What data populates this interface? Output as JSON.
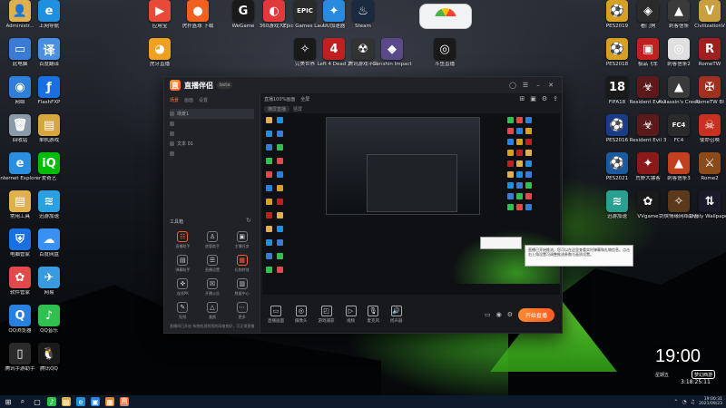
{
  "desktop": {
    "left_icons": [
      {
        "label": "Administr...",
        "icon": "user-folder-icon",
        "color": "#e0b050",
        "glyph": "👤"
      },
      {
        "label": "上网导航",
        "icon": "edge-icon",
        "color": "#1f8fe0",
        "glyph": "e"
      },
      {
        "label": "此电脑",
        "icon": "computer-icon",
        "color": "#3a7bd5",
        "glyph": "▭"
      },
      {
        "label": "百度翻译",
        "icon": "translate-icon",
        "color": "#4a90e2",
        "glyph": "译"
      },
      {
        "label": "网络",
        "icon": "network-icon",
        "color": "#2f7ed8",
        "glyph": "◉"
      },
      {
        "label": "FlashFXP",
        "icon": "flashfxp-icon",
        "color": "#1a6fe0",
        "glyph": "ƒ"
      },
      {
        "label": "回收站",
        "icon": "recycle-bin-icon",
        "color": "#8a9aa8",
        "glyph": "🗑"
      },
      {
        "label": "单机游戏",
        "icon": "folder-icon",
        "color": "#d8a640",
        "glyph": "▤"
      },
      {
        "label": "Internet Explorer",
        "icon": "ie-icon",
        "color": "#2a8fe0",
        "glyph": "e"
      },
      {
        "label": "爱奇艺",
        "icon": "iqiyi-icon",
        "color": "#00be06",
        "glyph": "iQ"
      },
      {
        "label": "常用工具",
        "icon": "tools-folder-icon",
        "color": "#e0b050",
        "glyph": "▤"
      },
      {
        "label": "迅游加速",
        "icon": "accelerator-icon",
        "color": "#2aa0e0",
        "glyph": "≋"
      },
      {
        "label": "电脑管家",
        "icon": "shield-icon",
        "color": "#1a70e0",
        "glyph": "⛨"
      },
      {
        "label": "百度网盘",
        "icon": "cloud-icon",
        "color": "#3a90f0",
        "glyph": "☁"
      },
      {
        "label": "软件管家",
        "icon": "software-manager-icon",
        "color": "#e04a4a",
        "glyph": "✿"
      },
      {
        "label": "网易",
        "icon": "plane-icon",
        "color": "#3a9ae0",
        "glyph": "✈"
      },
      {
        "label": "QQ浏览器",
        "icon": "qq-browser-icon",
        "color": "#2a80e0",
        "glyph": "Q"
      },
      {
        "label": "QQ音乐",
        "icon": "qq-music-icon",
        "color": "#30c050",
        "glyph": "♪"
      },
      {
        "label": "腾讯手游助手",
        "icon": "phone-game-icon",
        "color": "#2a2a2a",
        "glyph": "▯"
      },
      {
        "label": "腾讯QQ",
        "icon": "qq-icon",
        "color": "#1a1a1a",
        "glyph": "🐧"
      }
    ],
    "top_icons": [
      {
        "label": "应用宝",
        "icon": "app-store-icon",
        "color": "#e84a3a",
        "glyph": "▶"
      },
      {
        "label": "虎扑篮球 下载",
        "icon": "basketball-icon",
        "color": "#f06020",
        "glyph": "●"
      },
      {
        "label": "WeGame",
        "icon": "wegame-icon",
        "color": "#1a1a1a",
        "glyph": "G"
      },
      {
        "label": "360游戏大厅",
        "icon": "game360-icon",
        "color": "#e03a3a",
        "glyph": "◐"
      },
      {
        "label": "Epic Games Launcher",
        "icon": "epic-icon",
        "color": "#2a2a2a",
        "glyph": "EPIC"
      },
      {
        "label": "UU加速器",
        "icon": "uu-icon",
        "color": "#2a8ae0",
        "glyph": "✦"
      },
      {
        "label": "Steam",
        "icon": "steam-icon",
        "color": "#1a2a40",
        "glyph": "♨"
      },
      {
        "label": "虎牙直播",
        "icon": "huya-icon",
        "color": "#f0a020",
        "glyph": "◕"
      },
      {
        "label": "完美世界",
        "icon": "perfect-world-icon",
        "color": "#1a1a1a",
        "glyph": "✧"
      },
      {
        "label": "Left 4 Dead 2",
        "icon": "l4d2-icon",
        "color": "#c02020",
        "glyph": "4"
      },
      {
        "label": "腾讯游戏平台",
        "icon": "tencent-game-icon",
        "color": "#333",
        "glyph": "☢"
      },
      {
        "label": "Genshin Impact",
        "icon": "genshin-icon",
        "color": "#5a4a8a",
        "glyph": "◆"
      },
      {
        "label": "斗鱼直播",
        "icon": "douyu-icon",
        "color": "#1a1a1a",
        "glyph": "◎"
      }
    ],
    "right_icons": [
      {
        "label": "PES2019",
        "icon": "pes-icon",
        "color": "#d8a020",
        "glyph": "⚽"
      },
      {
        "label": "看门狗",
        "icon": "watchdogs-icon",
        "color": "#2a2a2a",
        "glyph": "◈"
      },
      {
        "label": "刺客信条",
        "icon": "assassin-icon",
        "color": "#3a3a3a",
        "glyph": "▲"
      },
      {
        "label": "CivilizationV",
        "icon": "civ-icon",
        "color": "#c8a040",
        "glyph": "V"
      },
      {
        "label": "PES2018",
        "icon": "pes2018-icon",
        "color": "#d8a020",
        "glyph": "⚽"
      },
      {
        "label": "极品飞车",
        "icon": "nfs-icon",
        "color": "#c02020",
        "glyph": "▣"
      },
      {
        "label": "刺客信条2",
        "icon": "assassin2-icon",
        "color": "#e0e0e0",
        "glyph": "◎"
      },
      {
        "label": "RomeTW",
        "icon": "rome-icon",
        "color": "#a02020",
        "glyph": "R"
      },
      {
        "label": "FIFA18",
        "icon": "fifa-icon",
        "color": "#1a1a1a",
        "glyph": "18"
      },
      {
        "label": "Resident Evil 2",
        "icon": "re2-icon",
        "color": "#5a1a1a",
        "glyph": "☣"
      },
      {
        "label": "Assassin's Creed",
        "icon": "ac-icon",
        "color": "#3a3a3a",
        "glyph": "▲"
      },
      {
        "label": "RomeTW BI",
        "icon": "rome-bi-icon",
        "color": "#a03020",
        "glyph": "✠"
      },
      {
        "label": "PES2016",
        "icon": "pes2016-icon",
        "color": "#1a3a8a",
        "glyph": "⚽"
      },
      {
        "label": "Resident Evil 3",
        "icon": "re3-icon",
        "color": "#5a1a1a",
        "glyph": "☣"
      },
      {
        "label": "FC4",
        "icon": "farcry-icon",
        "color": "#2a2a2a",
        "glyph": "FC4"
      },
      {
        "label": "使命召唤",
        "icon": "cod-icon",
        "color": "#c83020",
        "glyph": "☠"
      },
      {
        "label": "PES2021",
        "icon": "pes2021-icon",
        "color": "#1a5aa0",
        "glyph": "⚽"
      },
      {
        "label": "荒野大镖客",
        "icon": "rdr-icon",
        "color": "#8a1a1a",
        "glyph": "✦"
      },
      {
        "label": "刺客信条3",
        "icon": "ac3-icon",
        "color": "#c04020",
        "glyph": "▲"
      },
      {
        "label": "Rome2",
        "icon": "rome2-icon",
        "color": "#8a4a1a",
        "glyph": "⚔"
      },
      {
        "label": "迅游加速",
        "icon": "xunyou-icon",
        "color": "#2aa090",
        "glyph": "≋"
      },
      {
        "label": "VVgame",
        "icon": "vvgame-icon",
        "color": "#1a1a1a",
        "glyph": "✿"
      },
      {
        "label": "剑侠情缘网络版叁",
        "icon": "jx3-icon",
        "color": "#5a3a1a",
        "glyph": "✧"
      },
      {
        "label": "Lively Wallpaper",
        "icon": "lively-icon",
        "color": "#1a1a2a",
        "glyph": "⇅"
      }
    ]
  },
  "app": {
    "name": "直播伴侣",
    "version": "beta",
    "side_tabs": [
      "场景",
      "画面",
      "设置"
    ],
    "scenes": [
      {
        "label": "场景1"
      },
      {
        "label": ""
      },
      {
        "label": ""
      },
      {
        "label": "文本 01"
      },
      {
        "label": ""
      }
    ],
    "tools_title": "工具箱",
    "tools": [
      {
        "label": "直播助手",
        "glyph": "☷",
        "hot": true
      },
      {
        "label": "房管助手",
        "glyph": "♙",
        "hot": false
      },
      {
        "label": "主播任务",
        "glyph": "▣",
        "hot": false
      },
      {
        "label": "弹幕助手",
        "glyph": "▤",
        "hot": false
      },
      {
        "label": "直播设置",
        "glyph": "☰",
        "hot": false
      },
      {
        "label": "礼物特效",
        "glyph": "▦",
        "hot": true
      },
      {
        "label": "连线PK",
        "glyph": "✜",
        "hot": false
      },
      {
        "label": "开播公告",
        "glyph": "☒",
        "hot": false
      },
      {
        "label": "数据中心",
        "glyph": "▥",
        "hot": false
      },
      {
        "label": "贴纸",
        "glyph": "✎",
        "hot": false
      },
      {
        "label": "美颜",
        "glyph": "△",
        "hot": false
      },
      {
        "label": "更多",
        "glyph": "⋯",
        "hot": false
      }
    ],
    "notice": "直播间已开启·系统检测到您的网络良好，可正常直播",
    "main_top": [
      "直播100%画面",
      "全屏"
    ],
    "main_sub": [
      "横屏直播",
      "竖屏"
    ],
    "bottom_tools": [
      {
        "label": "直播画面",
        "glyph": "▭"
      },
      {
        "label": "摄像头",
        "glyph": "◎"
      },
      {
        "label": "游戏捕获",
        "glyph": "◰"
      },
      {
        "label": "视频",
        "glyph": "▷"
      },
      {
        "label": "麦克风",
        "glyph": "🎙"
      },
      {
        "label": "扬声器",
        "glyph": "🔊"
      }
    ],
    "start_live": "开始直播"
  },
  "popup": {
    "text": "直播已开始推流，您可以在这里查看实时弹幕和礼物信息。点击右上角设置可调整推流参数与画质设置。"
  },
  "clock": {
    "time": "19:00",
    "date": "星期五",
    "stamp": "梦幻西游",
    "sub": "3:18:25:11"
  },
  "taskbar": {
    "tray_time": "19:00:31",
    "tray_date": "2021/09/23"
  },
  "colors": {
    "accent": "#ff6a2e",
    "taskbar": "#0d1a2b"
  }
}
